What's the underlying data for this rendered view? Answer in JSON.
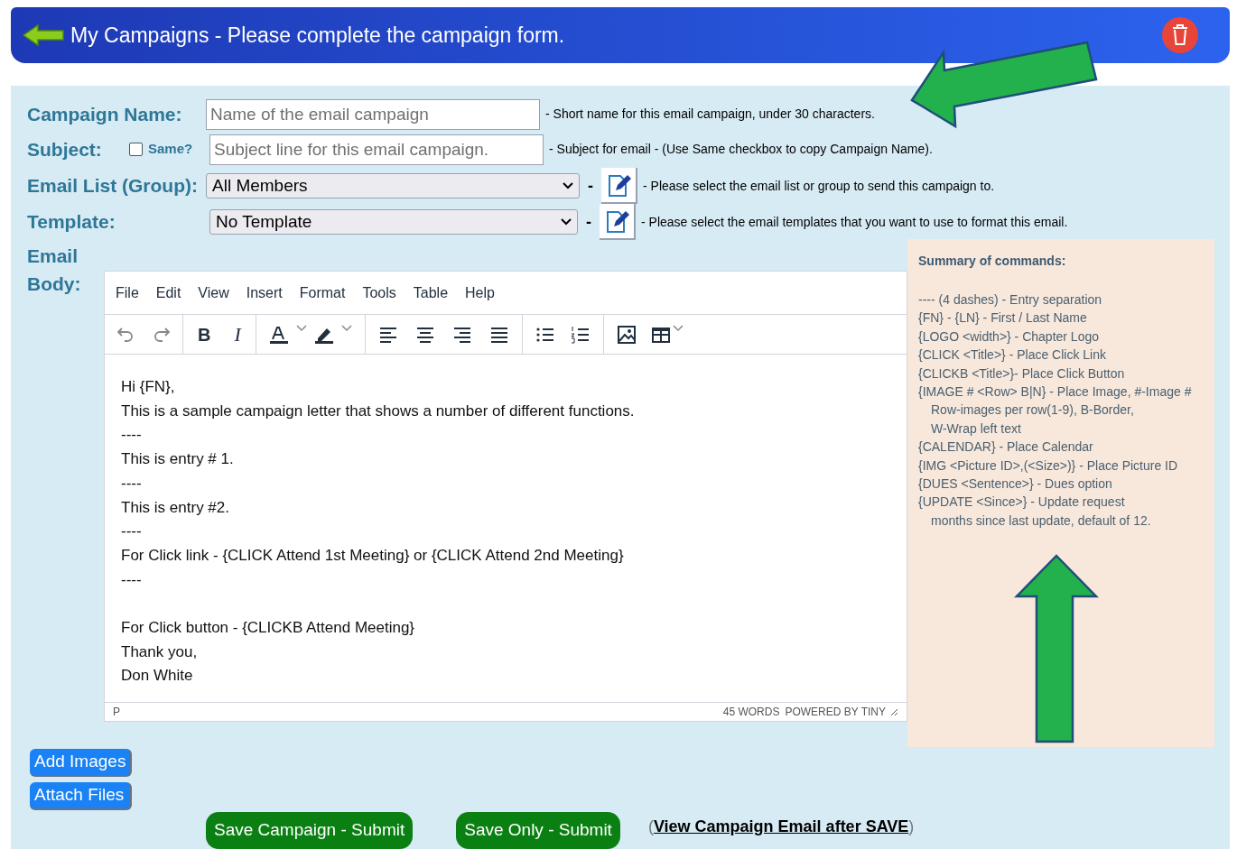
{
  "header": {
    "title": "My Campaigns - Please complete the campaign form."
  },
  "form": {
    "campaign_name": {
      "label": "Campaign Name:",
      "placeholder": "Name of the email campaign",
      "hint": "- Short name for this email campaign, under 30 characters."
    },
    "subject": {
      "label": "Subject:",
      "same_label": "Same?",
      "same_checked": false,
      "placeholder": "Subject line for this email campaign.",
      "hint": "- Subject for email - (Use Same checkbox to copy Campaign Name)."
    },
    "email_list": {
      "label": "Email List (Group):",
      "value": "All Members",
      "dash": "-",
      "hint": "- Please select the email list or group to send this campaign to."
    },
    "template": {
      "label": "Template:",
      "value": "No Template",
      "dash": "-",
      "hint": "- Please select the email templates that you want to use to format this email."
    },
    "body_label": [
      "Email",
      "Body:"
    ]
  },
  "editor": {
    "menu": [
      "File",
      "Edit",
      "View",
      "Insert",
      "Format",
      "Tools",
      "Table",
      "Help"
    ],
    "bold_label": "B",
    "italic_label": "I",
    "lines": [
      {
        "kind": "text",
        "text": "Hi {FN},"
      },
      {
        "kind": "text",
        "text": "This is a sample campaign letter that shows a number of different functions."
      },
      {
        "kind": "text",
        "text": "----"
      },
      {
        "kind": "text",
        "text": "This is entry # 1."
      },
      {
        "kind": "text",
        "text": "----"
      },
      {
        "kind": "text",
        "text": "This is entry #2."
      },
      {
        "kind": "text",
        "text": "----"
      },
      {
        "kind": "text",
        "text": "For Click link - {CLICK Attend 1st Meeting} or {CLICK Attend 2nd Meeting}"
      },
      {
        "kind": "text",
        "text": "----"
      },
      {
        "kind": "blank"
      },
      {
        "kind": "text",
        "text": "For Click button - {CLICKB Attend Meeting}"
      },
      {
        "kind": "text",
        "text": "Thank you,"
      },
      {
        "kind": "text",
        "text": "Don White"
      }
    ],
    "status_path": "P",
    "word_count": "45 WORDS",
    "powered_by": "POWERED BY TINY"
  },
  "summary": {
    "title": "Summary of commands:",
    "items": [
      {
        "text": "---- (4 dashes) - Entry separation",
        "continued": false
      },
      {
        "text": "{FN} - {LN} - First / Last Name",
        "continued": false
      },
      {
        "text": "{LOGO <width>} - Chapter Logo",
        "continued": false
      },
      {
        "text": "{CLICK <Title>} - Place Click Link",
        "continued": false
      },
      {
        "text": "{CLICKB <Title>}- Place Click Button",
        "continued": false
      },
      {
        "text": "{IMAGE # <Row> B|N} - Place Image, #-Image #",
        "continued": false
      },
      {
        "text": "Row-images per row(1-9), B-Border,",
        "continued": true
      },
      {
        "text": "W-Wrap left text",
        "continued": true
      },
      {
        "text": "{CALENDAR} - Place Calendar",
        "continued": false
      },
      {
        "text": "{IMG <Picture ID>,(<Size>)} - Place Picture ID",
        "continued": false
      },
      {
        "text": "{DUES <Sentence>} - Dues option",
        "continued": false
      },
      {
        "text": "{UPDATE <Since>} - Update request",
        "continued": false
      },
      {
        "text": "months since last update, default of 12.",
        "continued": true
      }
    ]
  },
  "side_buttons": [
    "Add Images",
    "Attach Files"
  ],
  "submit_buttons": [
    "Save Campaign - Submit",
    "Save Only - Submit"
  ],
  "view_link": {
    "open": "(",
    "text": "View Campaign Email after SAVE",
    "close": ")"
  }
}
